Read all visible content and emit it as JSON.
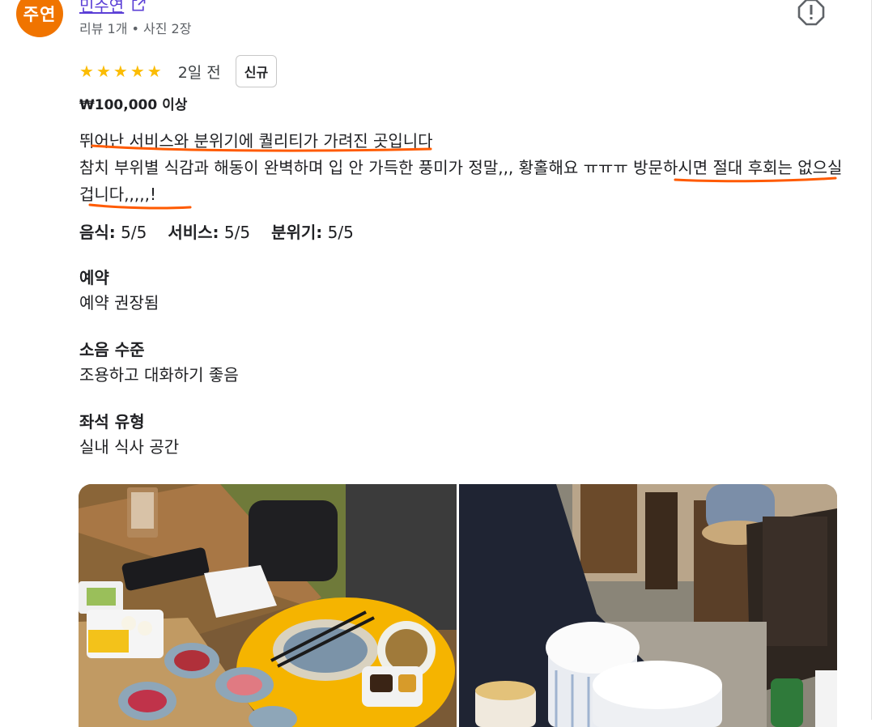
{
  "author": {
    "avatar_text": "주연",
    "name": "민주연",
    "meta": "리뷰 1개 • 사진 2장"
  },
  "rating": {
    "stars": 5,
    "time_ago": "2일 전",
    "badge": "신규"
  },
  "price": "₩100,000 이상",
  "review": {
    "line1": "뛰어난 서비스와 분위기에 퀄리티가 가려진 곳입니다",
    "line2": "참치 부위별 식감과 해동이 완벽하며 입 안 가득한 풍미가 정말,,, 황홀해요 ㅠㅠㅠ 방문하시면 절대 후회는 없으실겁니다,,,,,!"
  },
  "scores": [
    {
      "label": "음식:",
      "value": "5/5"
    },
    {
      "label": "서비스:",
      "value": "5/5"
    },
    {
      "label": "분위기:",
      "value": "5/5"
    }
  ],
  "details": [
    {
      "heading": "예약",
      "value": "예약 권장됨"
    },
    {
      "heading": "소음 수준",
      "value": "조용하고 대화하기 좋음"
    },
    {
      "heading": "좌석 유형",
      "value": "실내 식사 공간"
    }
  ],
  "colors": {
    "avatar_bg": "#f07400",
    "star": "#fbbc04",
    "author_link": "#5b3fd6",
    "annotation": "#ff5a00"
  },
  "icons": [
    "external-link-icon",
    "report-icon",
    "star-icon"
  ]
}
